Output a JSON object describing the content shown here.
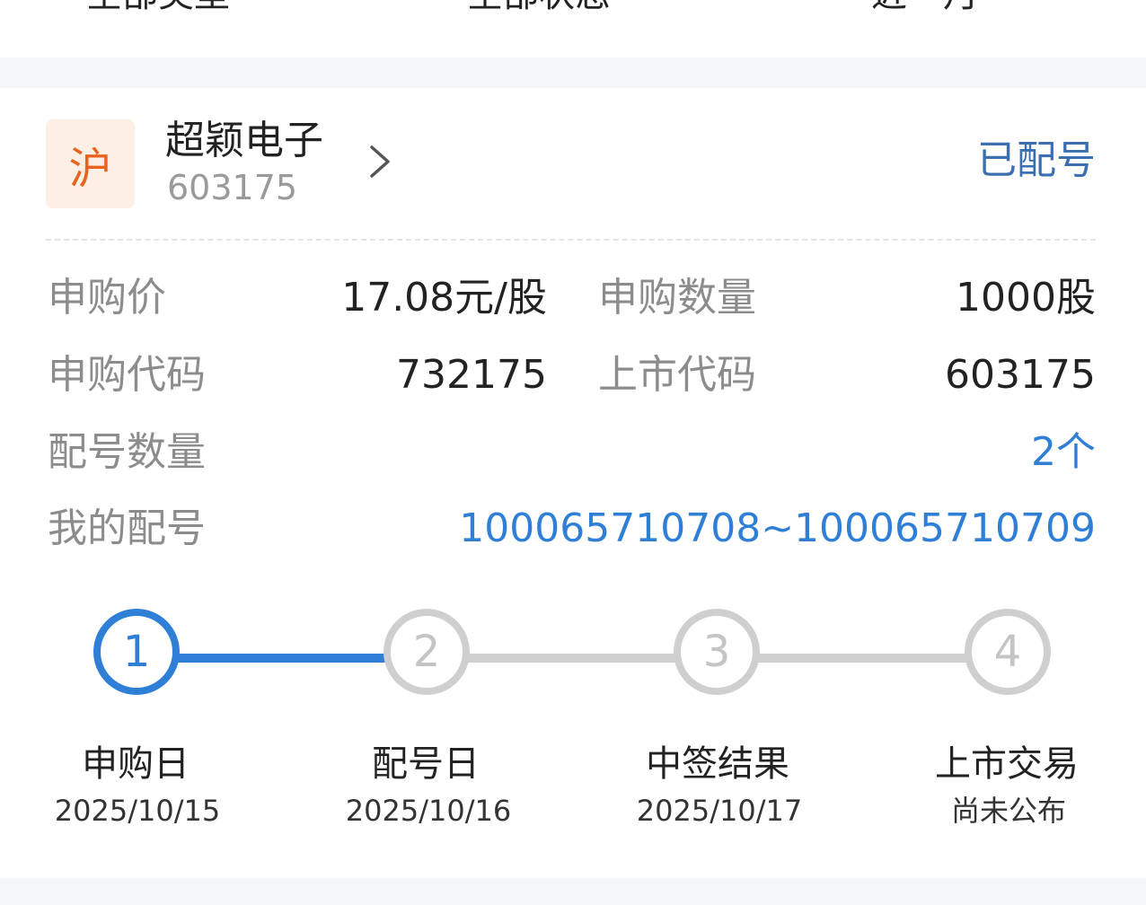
{
  "filters": [
    "全部类型",
    "全部状态",
    "近一月"
  ],
  "stock": {
    "market": "沪",
    "name": "超颖电子",
    "code": "603175",
    "status": "已配号"
  },
  "details": {
    "price_label": "申购价",
    "price_value": "17.08元/股",
    "qty_label": "申购数量",
    "qty_value": "1000股",
    "sub_code_label": "申购代码",
    "sub_code_value": "732175",
    "list_code_label": "上市代码",
    "list_code_value": "603175",
    "alloc_count_label": "配号数量",
    "alloc_count_value": "2个",
    "my_alloc_label": "我的配号",
    "my_alloc_value": "100065710708~100065710709"
  },
  "steps": [
    {
      "num": "1",
      "title": "申购日",
      "date": "2025/10/15",
      "active": true
    },
    {
      "num": "2",
      "title": "配号日",
      "date": "2025/10/16",
      "active": false
    },
    {
      "num": "3",
      "title": "中签结果",
      "date": "2025/10/17",
      "active": false
    },
    {
      "num": "4",
      "title": "上市交易",
      "date": "尚未公布",
      "active": false
    }
  ],
  "colors": {
    "accent": "#2f7fd6",
    "status": "#3b6fb0",
    "market_badge_bg": "#fdeee6",
    "market_badge_text": "#e8641e",
    "inactive_step": "#cfcfcf"
  }
}
